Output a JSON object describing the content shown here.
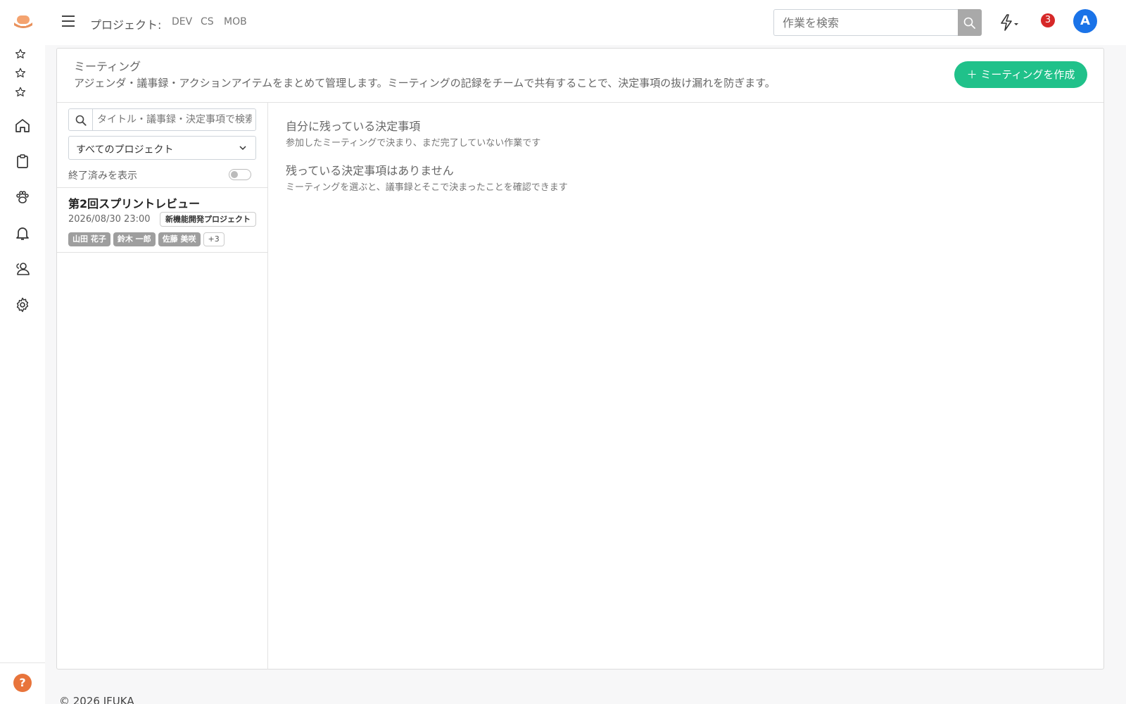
{
  "sidebar": {
    "favorites": [
      "star-icon",
      "star-icon",
      "star-icon"
    ],
    "nav": [
      {
        "icon": "home-icon",
        "label": ""
      },
      {
        "icon": "clipboard-icon",
        "label": ""
      },
      {
        "icon": "paw-icon",
        "label": ""
      },
      {
        "icon": "bell-icon",
        "label": ""
      },
      {
        "icon": "users-icon",
        "label": ""
      },
      {
        "icon": "gear-icon",
        "label": ""
      }
    ],
    "help": "?"
  },
  "topbar": {
    "project_label": "プロジェクト:",
    "projects": [
      "DEV",
      "CS",
      "MOB"
    ],
    "search_placeholder": "作業を検索",
    "notification_count": "3",
    "avatar_initial": "A"
  },
  "page": {
    "title": "ミーティング",
    "description": "アジェンダ・議事録・アクションアイテムをまとめて管理します。ミーティングの記録をチームで共有することで、決定事項の抜け漏れを防ぎます。",
    "create_button": "＋ ミーティングを作成"
  },
  "filters": {
    "search_placeholder": "タイトル・議事録・決定事項で検索",
    "project_select": "すべてのプロジェクト",
    "show_closed": "終了済みを表示"
  },
  "meetings": [
    {
      "title": "第2回スプリントレビュー",
      "date": "2026/08/30 23:00",
      "project": "新機能開発プロジェクト",
      "attendees": [
        "山田 花子",
        "鈴木 一郎",
        "佐藤 美咲"
      ],
      "more": "+3"
    }
  ],
  "remaining": {
    "title": "自分に残っている決定事項",
    "subtitle": "参加したミーティングで決まり、まだ完了していない作業です",
    "empty_title": "残っている決定事項はありません",
    "empty_subtitle": "ミーティングを選ぶと、議事録とそこで決まったことを確認できます"
  },
  "footer": "© 2026 IFUKA",
  "colors": {
    "accent": "#20c18a",
    "badge": "#d62828",
    "avatar": "#1a73e8",
    "help": "#e8743b"
  }
}
